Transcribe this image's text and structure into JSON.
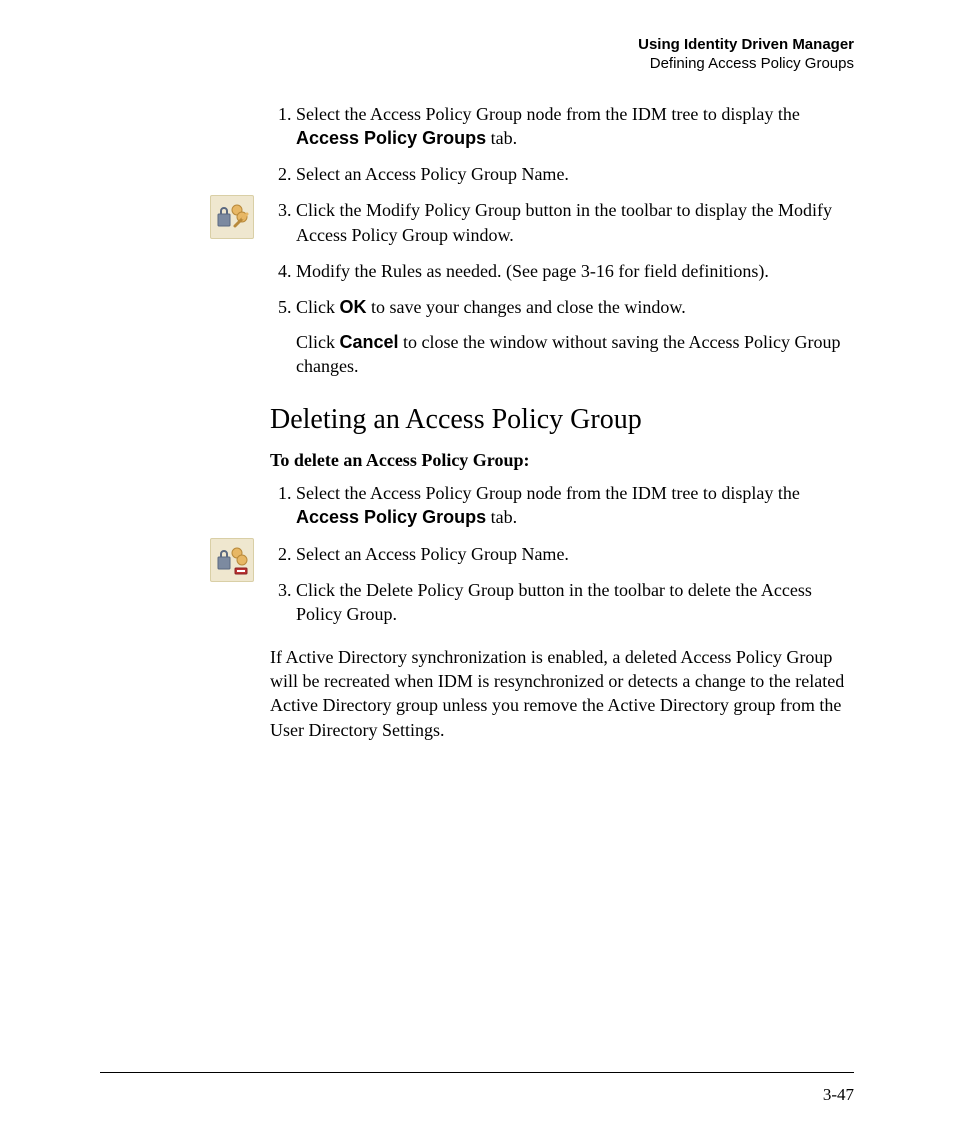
{
  "header": {
    "line1": "Using Identity Driven Manager",
    "line2": "Defining Access Policy Groups"
  },
  "steps1": {
    "s1a": "Select the Access Policy Group node from the IDM tree to display the ",
    "s1b": "Access Policy Groups",
    "s1c": " tab.",
    "s2": "Select an Access Policy Group Name.",
    "s3": "Click the Modify Policy Group button in the toolbar to display the Modify Access Policy Group window.",
    "s4": "Modify the Rules as needed. (See page 3-16 for field definitions).",
    "s5a": "Click ",
    "s5b": "OK",
    "s5c": " to save your changes and close the window.",
    "s5fa": "Click ",
    "s5fb": "Cancel",
    "s5fc": " to close the window without saving the Access Policy Group changes."
  },
  "section2": {
    "heading": "Deleting an Access Policy Group",
    "lead": "To delete an Access Policy Group:"
  },
  "steps2": {
    "s1a": "Select the Access Policy Group node from the IDM tree to display the ",
    "s1b": "Access Policy Groups",
    "s1c": " tab.",
    "s2": "Select an Access Policy Group Name.",
    "s3": "Click the Delete Policy Group button in the toolbar to delete the Access Policy Group."
  },
  "note": "If Active Directory synchronization is enabled, a deleted Access Policy Group will be recreated when IDM is resynchronized or detects a change to the related Active Directory group unless you remove the Active Directory group from the User Directory Settings.",
  "pagenum": "3-47"
}
